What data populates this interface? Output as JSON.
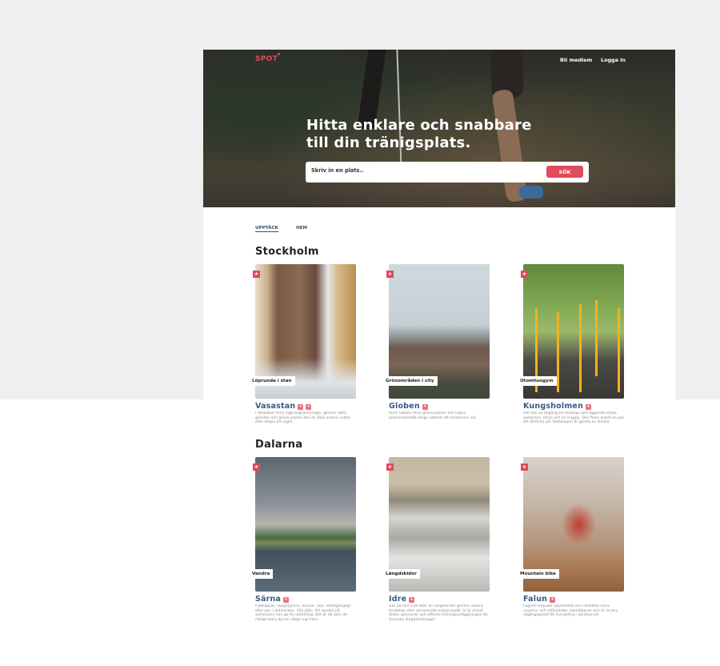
{
  "header": {
    "logo": "SPOT",
    "nav": [
      "Bli medlem",
      "Logga in"
    ]
  },
  "hero": {
    "title_line1": "Hitta enklare och snabbare",
    "title_line2": "till din tränigsplats.",
    "search_placeholder": "Skriv in en plats..",
    "search_button": "SÖK"
  },
  "tabs": [
    {
      "label": "UPPTÄCK",
      "active": true
    },
    {
      "label": "HEM",
      "active": false
    }
  ],
  "sections": [
    {
      "title": "Stockholm",
      "cards": [
        {
          "category": "Löprunda i stan",
          "name": "Vasastan",
          "badge_icons": [
            "run-icon",
            "bike-icon"
          ],
          "description": "I Vasastan finns inga begränsningar, genom rätta gränder och gröna parker kan du följa andras rutter eller skapa din egen."
        },
        {
          "category": "Grönområden i city",
          "name": "Globen",
          "badge_icons": [
            "run-icon"
          ],
          "description": "Runt Globen finns gröna parker och lugna promenadstråk längs vattnet att motionera vid."
        },
        {
          "category": "Utomhusgym",
          "name": "Kungsholmen",
          "badge_icons": [
            "run-icon"
          ],
          "description": "Här har du tillgång till redskap som liggande stege, axelpress, chins och en trappa. Den finns också en yta att stretcha på. Redskapen är gjorda av stocka"
        }
      ]
    },
    {
      "title": "Dalarna",
      "cards": [
        {
          "category": "Vandra",
          "name": "Särna",
          "badge_icons": [
            "run-icon"
          ],
          "description": "Fjälltoppar, skogstjärnar, bäckar, älar, lättillgängligt eller ute i vildmarken. Välj själv. Att vandra på sommaren kan ge fin utdelning. Det är då som de riktigt stora djuren vågar sig fram."
        },
        {
          "category": "Längdskidor",
          "name": "Idre",
          "badge_icons": [
            "ski-icon"
          ],
          "description": "Här på Idre Fjäll åker du längdskidor genom vackra landskap eller utmanande motionsspår. Vi är också stolta sponsorer och officiell träningsanläggningen för Svenska längdlandslaget."
        },
        {
          "category": "Mountain bike",
          "name": "Falun",
          "badge_icons": [
            "bike-icon"
          ],
          "description": "Lugnet erbjuder uppmärkta och väldiktta cross country- och utförsleder, teknikbanor och är en bra utgångspunkt för turcykling i världsarvet."
        }
      ]
    }
  ],
  "colors": {
    "accent": "#e04a5a",
    "link": "#3a5a82",
    "page_bg": "#efefef"
  }
}
